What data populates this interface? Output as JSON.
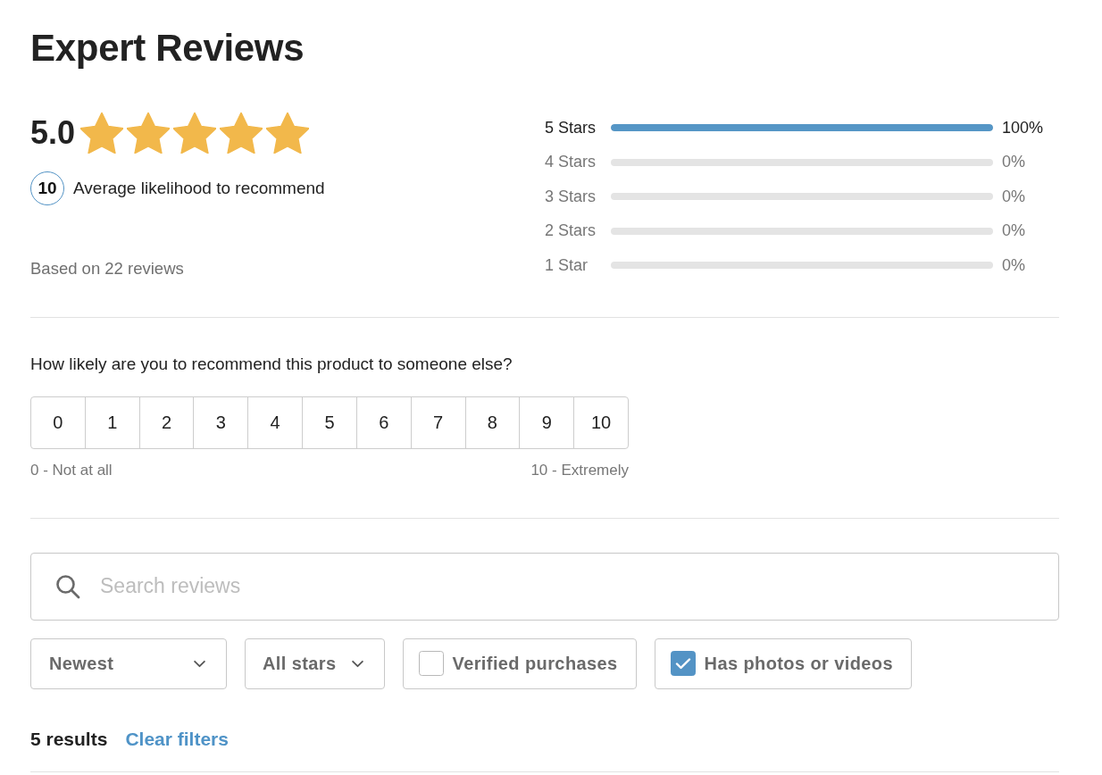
{
  "title": "Expert Reviews",
  "summary": {
    "score": "5.0",
    "stars": 5,
    "likelihood": "10",
    "likelihood_label": "Average likelihood to recommend",
    "based_on": "Based on 22 reviews"
  },
  "distribution": [
    {
      "label": "5 Stars",
      "level": 1,
      "percent": "100%"
    },
    {
      "label": "4 Stars",
      "level": 0,
      "percent": "0%"
    },
    {
      "label": "3 Stars",
      "level": 0,
      "percent": "0%"
    },
    {
      "label": "2 Stars",
      "level": 0,
      "percent": "0%"
    },
    {
      "label": "1 Star",
      "level": 0,
      "percent": "0%"
    }
  ],
  "recommend": {
    "question": "How likely are you to recommend this product to someone else?",
    "options": [
      {
        "label": "0",
        "selected": false
      },
      {
        "label": "1",
        "selected": false
      },
      {
        "label": "2",
        "selected": false
      },
      {
        "label": "3",
        "selected": false
      },
      {
        "label": "4",
        "selected": false
      },
      {
        "label": "5",
        "selected": false
      },
      {
        "label": "6",
        "selected": false
      },
      {
        "label": "7",
        "selected": false
      },
      {
        "label": "8",
        "selected": false
      },
      {
        "label": "9",
        "selected": false
      },
      {
        "label": "10",
        "selected": false
      }
    ],
    "low_label": "0 - Not at all",
    "high_label": "10 - Extremely"
  },
  "search": {
    "placeholder": "Search reviews"
  },
  "sort": {
    "label": "Newest"
  },
  "filters": [
    {
      "kind": "dropdown",
      "label": "All stars"
    },
    {
      "kind": "checkbox",
      "label": "Verified purchases",
      "checked": false
    },
    {
      "kind": "checkbox",
      "label": "Has photos or videos",
      "checked": true
    }
  ],
  "results": {
    "count": "5 results",
    "clear": "Clear filters"
  }
}
